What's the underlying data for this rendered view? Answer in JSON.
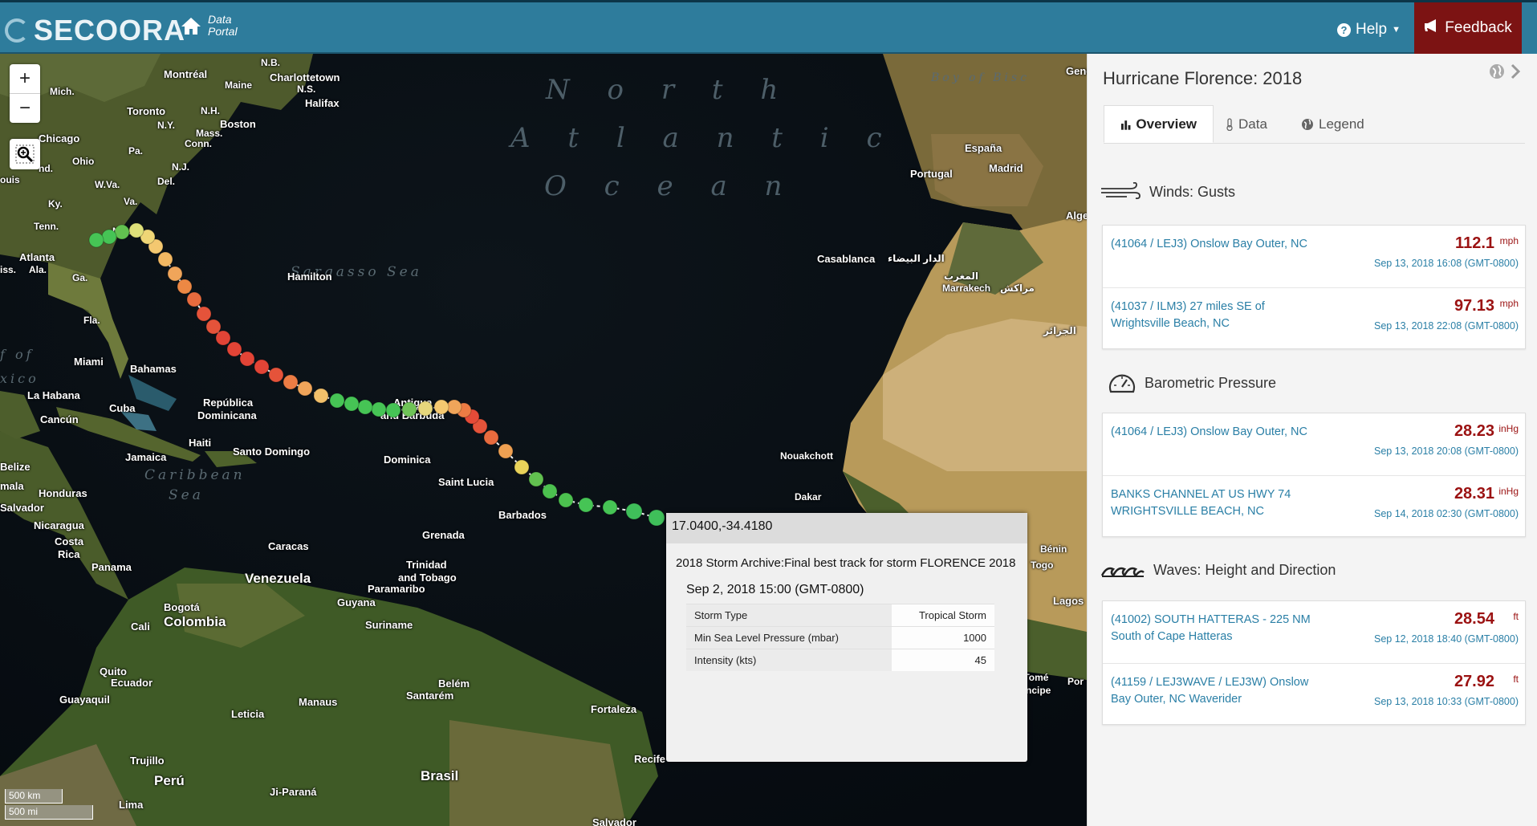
{
  "header": {
    "logo": "SECOORA",
    "data_portal_line1": "Data",
    "data_portal_line2": "Portal",
    "help": "Help",
    "feedback": "Feedback"
  },
  "map": {
    "zoom_in": "+",
    "zoom_out": "−",
    "scale_km": "500 km",
    "scale_mi": "500 mi",
    "ocean_label_1": "N o r t h",
    "ocean_label_2": "A t l a n t i c",
    "ocean_label_3": "O c e a n",
    "sargasso": "Sargasso Sea",
    "caribbean": "Caribbean",
    "caribbean_sea": "Sea",
    "biscay": "Boy of Bisc",
    "places": {
      "montreal": "Montréal",
      "maine": "Maine",
      "nb": "N.B.",
      "charlottetown": "Charlottetown",
      "ns": "N.S.",
      "halifax": "Halifax",
      "mich": "Mich.",
      "toronto": "Toronto",
      "nh": "N.H.",
      "ny": "N.Y.",
      "boston": "Boston",
      "mass": "Mass.",
      "conn": "Conn.",
      "chicago": "Chicago",
      "pa": "Pa.",
      "ohio": "Ohio",
      "nj": "N.J.",
      "ind": "nd.",
      "wva": "W.Va.",
      "del": "Del.",
      "ouis": "ouis",
      "ky": "Ky.",
      "va": "Va.",
      "tenn": "Tenn.",
      "nc": "N.C.",
      "atlanta": "Atlanta",
      "ala": "Ala.",
      "iss": "iss.",
      "ga": "Ga.",
      "fla": "Fla.",
      "hamilton": "Hamilton",
      "miami": "Miami",
      "bahamas": "Bahamas",
      "gulf1": "f of",
      "gulf2": "xico",
      "habana": "La Habana",
      "cuba": "Cuba",
      "cancun": "Cancún",
      "republica": "República",
      "dominicana": "Dominicana",
      "haiti": "Haiti",
      "jamaica": "Jamaica",
      "santo_domingo": "Santo Domingo",
      "antigua": "Antigua",
      "barbuda": "and Barbuda",
      "belize": "Belize",
      "mala": "mala",
      "honduras": "Honduras",
      "salvador_sv": "Salvador",
      "nicaragua": "Nicaragua",
      "costa": "Costa",
      "rica": "Rica",
      "panama": "Panama",
      "dominica": "Dominica",
      "saint_lucia": "Saint Lucia",
      "barbados": "Barbados",
      "grenada": "Grenada",
      "caracas": "Caracas",
      "venezuela": "Venezuela",
      "trinidad": "Trinidad",
      "tobago": "and Tobago",
      "paramaribo": "Paramaribo",
      "guyana": "Guyana",
      "suriname": "Suriname",
      "bogota": "Bogotá",
      "colombia": "Colombia",
      "cali": "Cali",
      "quito": "Quito",
      "ecuador": "Ecuador",
      "guayaquil": "Guayaquil",
      "belem": "Belém",
      "santarem": "Santarém",
      "manaus": "Manaus",
      "fortaleza": "Fortaleza",
      "leticia": "Leticia",
      "trujillo": "Trujillo",
      "peru": "Perú",
      "brasil": "Brasil",
      "recife": "Recife",
      "lima": "Lima",
      "jiparana": "Ji-Paraná",
      "salvador": "Salvador",
      "espana": "España",
      "madrid": "Madrid",
      "portugal": "Portugal",
      "geneva": "Genè",
      "alge": "Alge",
      "casablanca": "Casablanca",
      "casablanca_ar": "الدار البيضاء",
      "marrakech": "Marrakech",
      "marrakech_ar": "مراكش",
      "maghrib": "المغرب",
      "jazair": "الجزائر",
      "nouakchott": "Nouakchott",
      "dakar": "Dakar",
      "benin": "Bénin",
      "togo": "Togo",
      "lagos": "Lagos",
      "saotome": "São Tomé",
      "principe": "e Príncipe",
      "por": "Por"
    }
  },
  "popup": {
    "coords": "17.0400,-34.4180",
    "description": "2018 Storm Archive:Final best track for storm FLORENCE 2018",
    "time": "Sep 2, 2018 15:00 (GMT-0800)",
    "rows": [
      {
        "key": "Storm Type",
        "value": "Tropical Storm"
      },
      {
        "key": "Min Sea Level Pressure (mbar)",
        "value": "1000"
      },
      {
        "key": "Intensity (kts)",
        "value": "45"
      }
    ]
  },
  "sidebar": {
    "title": "Hurricane Florence: 2018",
    "tabs": [
      "Overview",
      "Data",
      "Legend"
    ],
    "sections": [
      {
        "title": "Winds: Gusts",
        "icon": "wind-icon",
        "items": [
          {
            "name": "(41064 / LEJ3) Onslow Bay Outer, NC",
            "value": "112.1",
            "unit": "mph",
            "time": "Sep 13, 2018 16:08 (GMT-0800)"
          },
          {
            "name": "(41037 / ILM3) 27 miles SE of Wrightsville Beach, NC",
            "value": "97.13",
            "unit": "mph",
            "time": "Sep 13, 2018 22:08 (GMT-0800)"
          }
        ]
      },
      {
        "title": "Barometric Pressure",
        "icon": "gauge-icon",
        "items": [
          {
            "name": "(41064 / LEJ3) Onslow Bay Outer, NC",
            "value": "28.23",
            "unit": "inHg",
            "time": "Sep 13, 2018 20:08 (GMT-0800)"
          },
          {
            "name": "BANKS CHANNEL AT US HWY 74 WRIGHTSVILLE BEACH, NC",
            "value": "28.31",
            "unit": "inHg",
            "time": "Sep 14, 2018 02:30 (GMT-0800)"
          }
        ]
      },
      {
        "title": "Waves: Height and Direction",
        "icon": "wave-icon",
        "items": [
          {
            "name": "(41002) SOUTH HATTERAS - 225 NM South of Cape Hatteras",
            "value": "28.54",
            "unit": "ft",
            "time": "Sep 12, 2018 18:40 (GMT-0800)"
          },
          {
            "name": "(41159 / LEJ3WAVE / LEJ3W) Onslow Bay Outer, NC Waverider",
            "value": "27.92",
            "unit": "ft",
            "time": "Sep 13, 2018 10:33 (GMT-0800)"
          }
        ]
      }
    ]
  }
}
